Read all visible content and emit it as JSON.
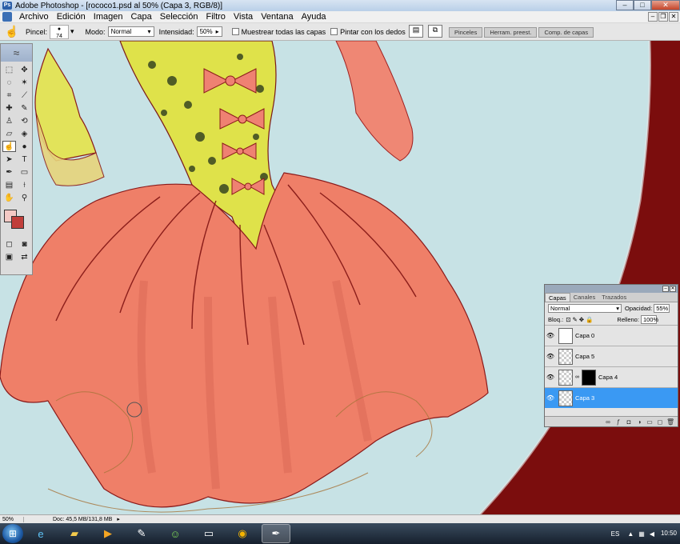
{
  "window": {
    "title": "Adobe Photoshop - [rococo1.psd al 50% (Capa 3, RGB/8)]",
    "app_icon": "Ps"
  },
  "window_controls": {
    "minimize": "–",
    "maximize": "□",
    "close": "✕"
  },
  "doc_controls": {
    "minimize": "–",
    "restore": "❐",
    "close": "✕"
  },
  "menu": [
    "Archivo",
    "Edición",
    "Imagen",
    "Capa",
    "Selección",
    "Filtro",
    "Vista",
    "Ventana",
    "Ayuda"
  ],
  "options": {
    "brush_label": "Pincel:",
    "brush_size": "74",
    "mode_label": "Modo:",
    "mode_value": "Normal",
    "strength_label": "Intensidad:",
    "strength_value": "50%",
    "sample_all_label": "Muestrear todas las capas",
    "finger_paint_label": "Pintar con los dedos"
  },
  "palette_well": [
    "Pinceles",
    "Herram. preest.",
    "Comp. de capas"
  ],
  "layers_panel": {
    "tabs": [
      "Capas",
      "Canales",
      "Trazados"
    ],
    "blend_mode": "Normal",
    "opacity_label": "Opacidad:",
    "opacity_value": "55%",
    "lock_label": "Bloq.:",
    "fill_label": "Relleno:",
    "fill_value": "100%",
    "layers": [
      {
        "name": "Capa 0",
        "visible": true,
        "selected": false
      },
      {
        "name": "Capa 5",
        "visible": true,
        "selected": false
      },
      {
        "name": "Capa 4",
        "visible": true,
        "selected": false,
        "has_mask": true
      },
      {
        "name": "Capa 3",
        "visible": true,
        "selected": true
      }
    ]
  },
  "status": {
    "zoom": "50%",
    "doc_info": "Doc: 45,5 MB/131,8 MB"
  },
  "taskbar": {
    "apps": [
      "internet-explorer",
      "windows-explorer",
      "media-player",
      "photoshop-app",
      "messenger",
      "display-app",
      "chrome",
      "photoshop-active"
    ],
    "language": "ES",
    "time": "10:50"
  },
  "colors": {
    "foreground": "#f4c9c5",
    "background": "#c13e3a",
    "canvas": "#c7e2e5",
    "skirt": "#ef7f68",
    "bodice": "#dfe24a",
    "accent": "#7b0d0d"
  }
}
